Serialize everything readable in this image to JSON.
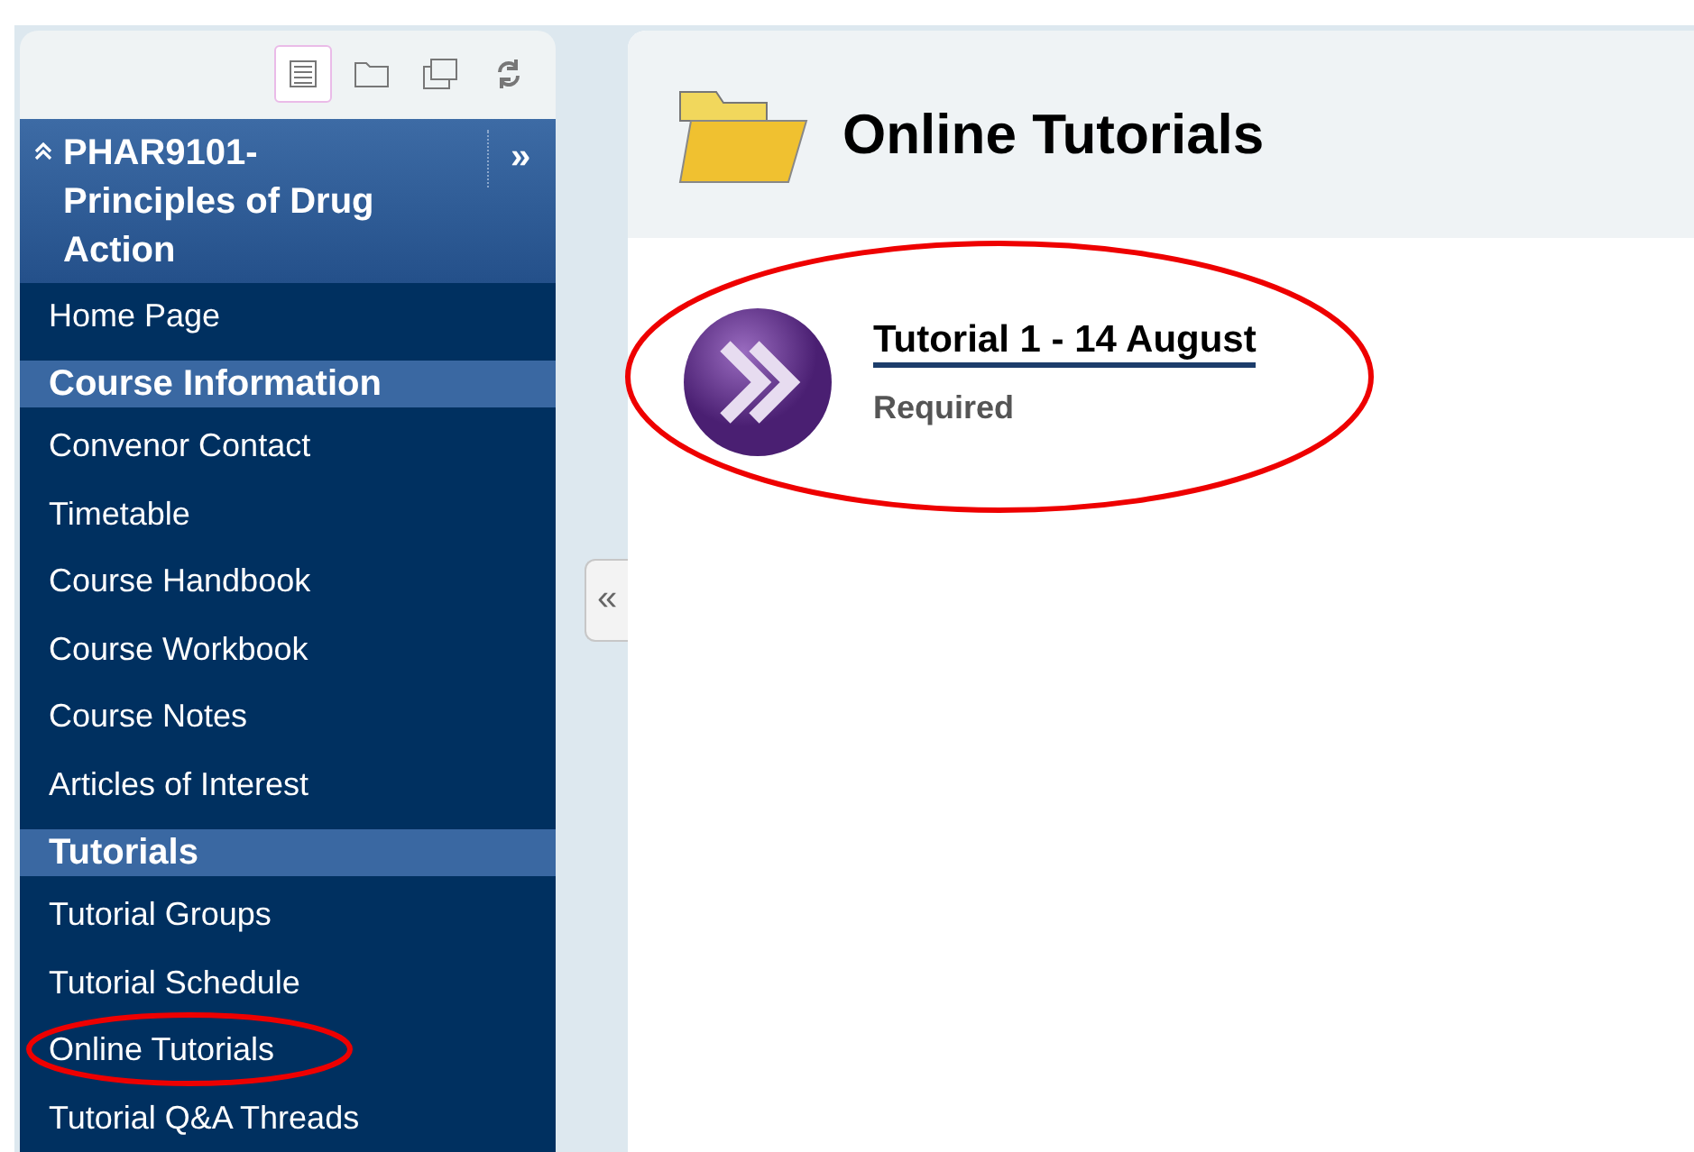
{
  "course": {
    "title": "PHAR9101-\nPrinciples of Drug\nAction",
    "expand_glyph": "»",
    "collapse_glyph": "«"
  },
  "toolbar": [
    {
      "kind": "list",
      "selected": true
    },
    {
      "kind": "folder",
      "selected": false
    },
    {
      "kind": "windows",
      "selected": false
    },
    {
      "kind": "refresh",
      "selected": false
    }
  ],
  "nav": [
    {
      "kind": "link",
      "label": "Home Page",
      "circled": false
    },
    {
      "kind": "section",
      "label": "Course Information"
    },
    {
      "kind": "link",
      "label": "Convenor Contact",
      "circled": false
    },
    {
      "kind": "link",
      "label": "Timetable",
      "circled": false
    },
    {
      "kind": "link",
      "label": "Course Handbook",
      "circled": false
    },
    {
      "kind": "link",
      "label": "Course Workbook",
      "circled": false
    },
    {
      "kind": "link",
      "label": "Course Notes",
      "circled": false
    },
    {
      "kind": "link",
      "label": "Articles of Interest",
      "circled": false
    },
    {
      "kind": "section",
      "label": "Tutorials"
    },
    {
      "kind": "link",
      "label": "Tutorial Groups",
      "circled": false
    },
    {
      "kind": "link",
      "label": "Tutorial Schedule",
      "circled": false
    },
    {
      "kind": "link",
      "label": "Online Tutorials",
      "circled": true
    },
    {
      "kind": "link",
      "label": "Tutorial Q&A Threads",
      "circled": false
    }
  ],
  "content": {
    "title": "Online Tutorials",
    "items": [
      {
        "title": "Tutorial 1 - 14 August",
        "status": "Required",
        "circled": true
      }
    ]
  }
}
